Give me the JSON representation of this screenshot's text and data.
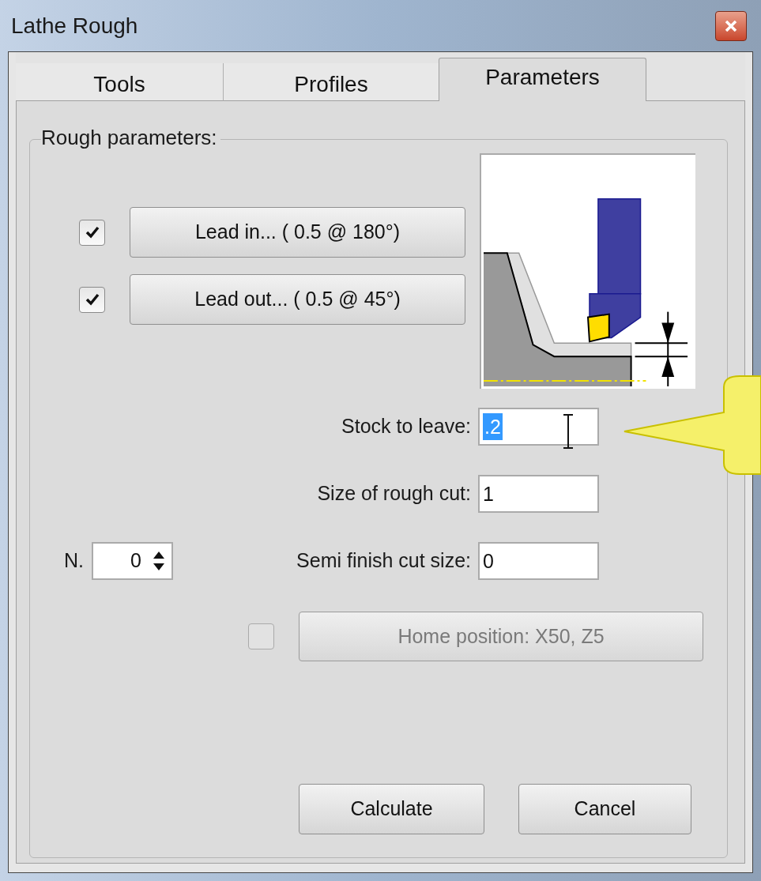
{
  "window": {
    "title": "Lathe Rough"
  },
  "tabs": [
    {
      "label": "Tools",
      "selected": false
    },
    {
      "label": "Profiles",
      "selected": false
    },
    {
      "label": "Parameters",
      "selected": true
    }
  ],
  "group": {
    "title": "Rough parameters:"
  },
  "lead_options": [
    {
      "label": "Lead in... ( 0.5 @ 180°)",
      "checked": true
    },
    {
      "label": "Lead out... ( 0.5 @ 45°)",
      "checked": true
    }
  ],
  "fields": [
    {
      "label": "Stock to leave:",
      "value": ".2",
      "selected": true
    },
    {
      "label": "Size of rough cut:",
      "value": "1",
      "selected": false
    },
    {
      "label": "Semi finish cut size:",
      "value": "0",
      "selected": false
    }
  ],
  "spinner": {
    "label": "N.",
    "value": "0"
  },
  "home": {
    "label": "Home position: X50, Z5",
    "checked": false,
    "disabled": true
  },
  "buttons": [
    "Calculate",
    "Cancel"
  ]
}
